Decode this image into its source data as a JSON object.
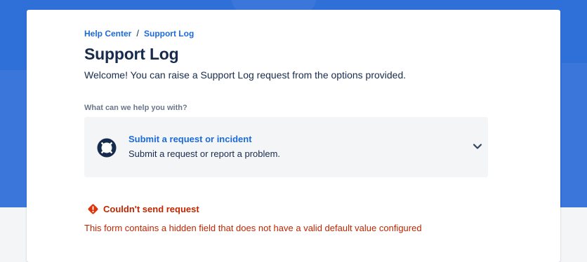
{
  "breadcrumb": {
    "home": "Help Center",
    "separator": "/",
    "current": "Support Log"
  },
  "page": {
    "title": "Support Log",
    "welcome": "Welcome! You can raise a Support Log request from the options provided."
  },
  "help": {
    "label": "What can we help you with?",
    "request_type": {
      "icon": "lifebuoy-icon",
      "title": "Submit a request or incident",
      "description": "Submit a request or report a problem."
    }
  },
  "error": {
    "icon": "warning-icon",
    "title": "Couldn't send request",
    "message": "This form contains a hidden field that does not have a valid default value configured"
  },
  "colors": {
    "banner": "#2f6fd8",
    "link": "#1b6ad8",
    "text": "#172b4d",
    "error": "#bf2600"
  }
}
